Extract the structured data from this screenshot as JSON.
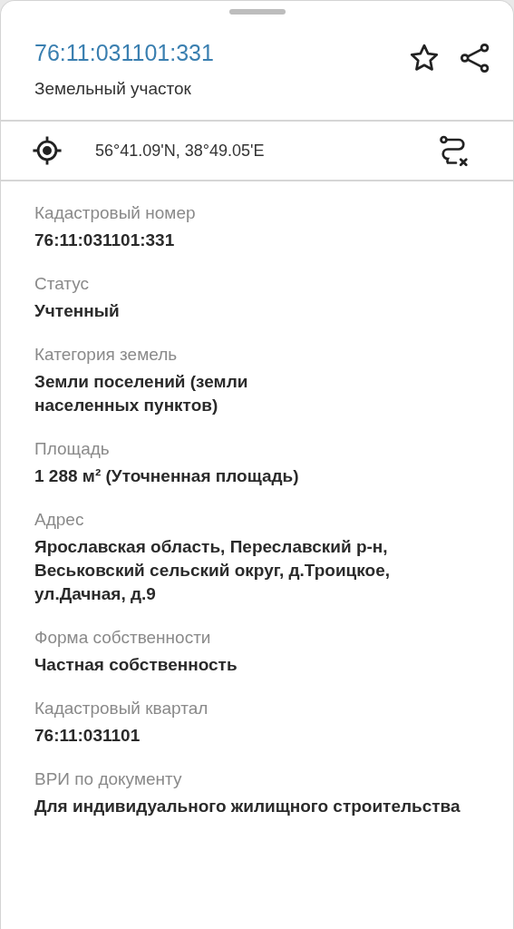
{
  "header": {
    "title": "76:11:031101:331",
    "subtitle": "Земельный участок",
    "favorite": false
  },
  "coordinates": {
    "text": "56°41.09'N, 38°49.05'E"
  },
  "fields": [
    {
      "label": "Кадастровый номер",
      "value": "76:11:031101:331"
    },
    {
      "label": "Статус",
      "value": "Учтенный"
    },
    {
      "label": "Категория земель",
      "value": "Земли поселений (земли\nнаселенных пунктов)"
    },
    {
      "label": "Площадь",
      "value": "1 288 м² (Уточненная площадь)"
    },
    {
      "label": "Адрес",
      "value": "Ярославская область, Переславский р-н, Веськовский сельский округ, д.Троицкое, ул.Дачная, д.9"
    },
    {
      "label": "Форма собственности",
      "value": "Частная собственность"
    },
    {
      "label": "Кадастровый квартал",
      "value": "76:11:031101"
    },
    {
      "label": "ВРИ по документу",
      "value": "Для индивидуального жилищного строительства"
    }
  ]
}
